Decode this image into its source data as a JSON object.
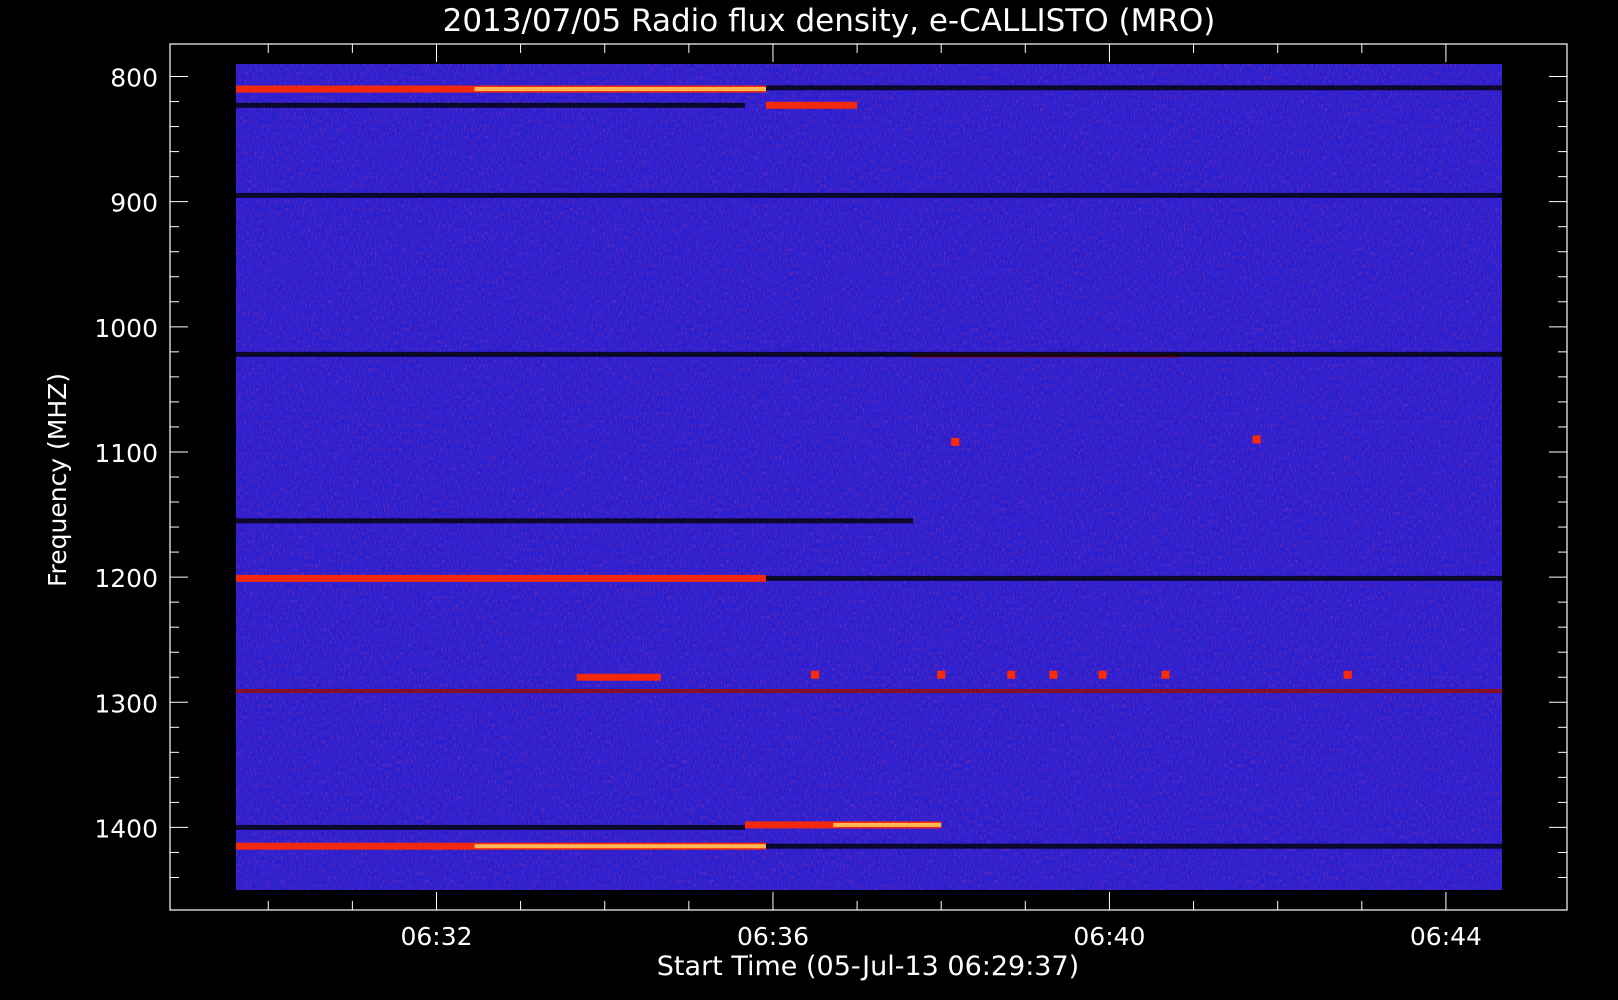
{
  "chart_data": {
    "type": "heatmap",
    "title": "2013/07/05  Radio flux density, e-CALLISTO (MRO)",
    "xlabel": "Start Time (05-Jul-13 06:29:37)",
    "ylabel": "Frequency (MHZ)",
    "x_ticks": [
      "06:32",
      "06:36",
      "06:40",
      "06:44"
    ],
    "y_ticks": [
      "800",
      "900",
      "1000",
      "1100",
      "1200",
      "1300",
      "1400"
    ],
    "xlim": [
      "06:29:37",
      "06:44:40"
    ],
    "ylim": [
      790,
      1450
    ],
    "colors": {
      "background": "#000000",
      "field": "#2a1fd0",
      "emission_low": "#8b1020",
      "emission_mid": "#ff2a00",
      "emission_high": "#ffd060",
      "absorption": "#05050f"
    },
    "features": [
      {
        "type": "emission",
        "freq_mhz": 810,
        "start": "06:29:37",
        "end": "06:35:55",
        "level": "high"
      },
      {
        "type": "emission",
        "freq_mhz": 1415,
        "start": "06:29:37",
        "end": "06:35:55",
        "level": "high"
      },
      {
        "type": "emission",
        "freq_mhz": 1398,
        "start": "06:35:40",
        "end": "06:38:00",
        "level": "high"
      },
      {
        "type": "emission",
        "freq_mhz": 823,
        "start": "06:35:55",
        "end": "06:37:00",
        "level": "mid"
      },
      {
        "type": "emission",
        "freq_mhz": 1201,
        "start": "06:29:37",
        "end": "06:35:55",
        "level": "mid"
      },
      {
        "type": "emission",
        "freq_mhz": 1280,
        "start": "06:33:40",
        "end": "06:34:40",
        "level": "mid"
      },
      {
        "type": "emission",
        "freq_mhz": 1291,
        "start": "06:29:37",
        "end": "06:44:40",
        "level": "low"
      },
      {
        "type": "emission",
        "freq_mhz": 1023,
        "start": "06:37:40",
        "end": "06:40:50",
        "level": "low"
      },
      {
        "type": "absorption",
        "freq_mhz": 809,
        "start": "06:35:55",
        "end": "06:44:40"
      },
      {
        "type": "absorption",
        "freq_mhz": 823,
        "start": "06:29:37",
        "end": "06:35:40"
      },
      {
        "type": "absorption",
        "freq_mhz": 895,
        "start": "06:29:37",
        "end": "06:44:40"
      },
      {
        "type": "absorption",
        "freq_mhz": 1022,
        "start": "06:29:37",
        "end": "06:44:40"
      },
      {
        "type": "absorption",
        "freq_mhz": 1155,
        "start": "06:29:37",
        "end": "06:37:40"
      },
      {
        "type": "absorption",
        "freq_mhz": 1201,
        "start": "06:35:55",
        "end": "06:44:40"
      },
      {
        "type": "absorption",
        "freq_mhz": 1400,
        "start": "06:29:37",
        "end": "06:35:40"
      },
      {
        "type": "absorption",
        "freq_mhz": 1415,
        "start": "06:35:55",
        "end": "06:44:40"
      }
    ],
    "spots": [
      {
        "freq_mhz": 1278,
        "time": "06:36:30"
      },
      {
        "freq_mhz": 1278,
        "time": "06:38:00"
      },
      {
        "freq_mhz": 1278,
        "time": "06:38:50"
      },
      {
        "freq_mhz": 1278,
        "time": "06:39:20"
      },
      {
        "freq_mhz": 1278,
        "time": "06:39:55"
      },
      {
        "freq_mhz": 1278,
        "time": "06:40:40"
      },
      {
        "freq_mhz": 1278,
        "time": "06:42:50"
      },
      {
        "freq_mhz": 1092,
        "time": "06:38:10"
      },
      {
        "freq_mhz": 1090,
        "time": "06:41:45"
      }
    ]
  }
}
